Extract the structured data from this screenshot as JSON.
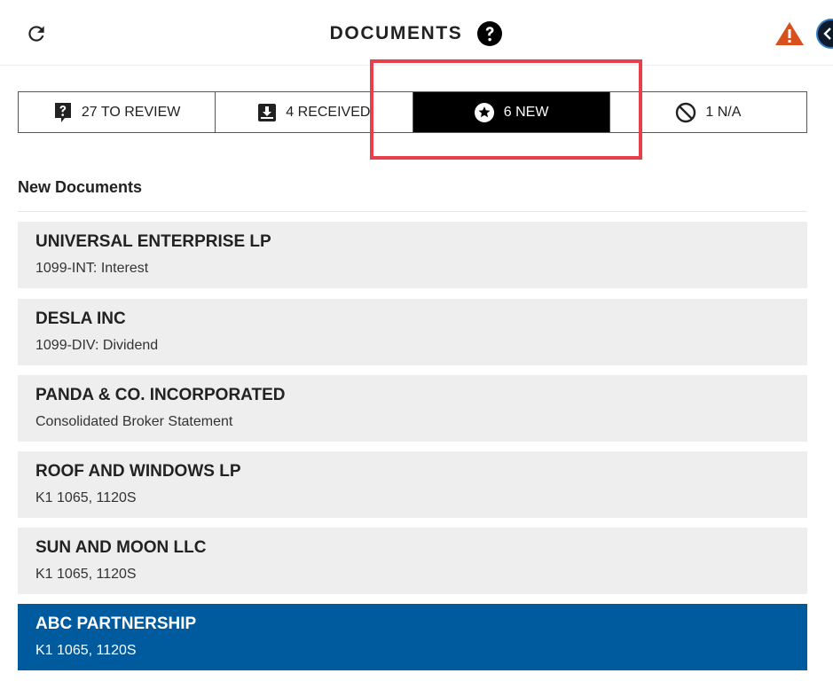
{
  "header": {
    "title": "DOCUMENTS",
    "refresh_icon": "refresh-icon",
    "help_icon": "question-circle-icon",
    "warning_icon": "warning-triangle-icon",
    "collapse_icon": "chevron-left-icon"
  },
  "tabs": [
    {
      "label": "27 TO REVIEW",
      "icon": "question-document-icon"
    },
    {
      "label": "4 RECEIVED",
      "icon": "inbox-download-icon"
    },
    {
      "label": "6 NEW",
      "icon": "star-circle-icon",
      "active": true
    },
    {
      "label": "1 N/A",
      "icon": "prohibited-icon"
    }
  ],
  "section": {
    "title": "New Documents"
  },
  "documents": [
    {
      "name": "UNIVERSAL ENTERPRISE LP",
      "type": "1099-INT: Interest"
    },
    {
      "name": "DESLA INC",
      "type": "1099-DIV: Dividend"
    },
    {
      "name": "PANDA & CO. INCORPORATED",
      "type": "Consolidated Broker Statement"
    },
    {
      "name": "ROOF AND WINDOWS LP",
      "type": "K1 1065, 1120S"
    },
    {
      "name": "SUN AND MOON LLC",
      "type": "K1 1065, 1120S"
    },
    {
      "name": "ABC PARTNERSHIP",
      "type": "K1 1065, 1120S",
      "selected": true
    }
  ],
  "colors": {
    "active_tab": "#000000",
    "selected_row": "#005a9e",
    "row_bg": "#eeeeee",
    "highlight": "#e8404a",
    "warning": "#d8501c"
  }
}
